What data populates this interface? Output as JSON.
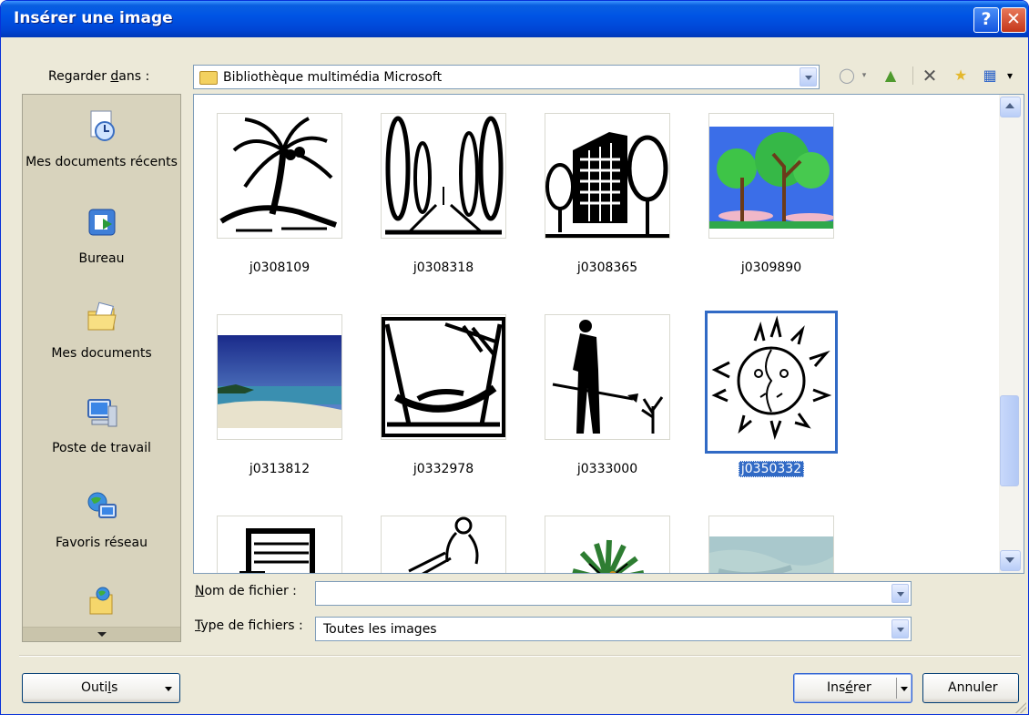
{
  "window": {
    "title": "Insérer une image",
    "help_glyph": "?",
    "close_glyph": "✕"
  },
  "look_in": {
    "label_prefix": "Regarder ",
    "label_access": "d",
    "label_suffix": "ans :",
    "value": "Bibliothèque multimédia Microsoft"
  },
  "toolbar": {
    "back": "◯",
    "up": "▲",
    "delete": "✕",
    "new_folder": "★",
    "views": "▦",
    "views_arrow": "▾"
  },
  "places": [
    {
      "label": "Mes documents récents",
      "icon": "recent-documents-icon"
    },
    {
      "label": "Bureau",
      "icon": "desktop-icon"
    },
    {
      "label": "Mes documents",
      "icon": "my-documents-icon"
    },
    {
      "label": "Poste de travail",
      "icon": "my-computer-icon"
    },
    {
      "label": "Favoris réseau",
      "icon": "network-places-icon"
    },
    {
      "label": "",
      "icon": "web-folder-icon"
    }
  ],
  "files": [
    {
      "name": "j0308109",
      "art": "palm-island"
    },
    {
      "name": "j0308318",
      "art": "tree-avenue"
    },
    {
      "name": "j0308365",
      "art": "building-trees"
    },
    {
      "name": "j0309890",
      "art": "color-trees"
    },
    {
      "name": "j0313812",
      "art": "beach-photo"
    },
    {
      "name": "j0332978",
      "art": "hammock"
    },
    {
      "name": "j0333000",
      "art": "person-shovel"
    },
    {
      "name": "j0350332",
      "art": "sun-face",
      "selected": true
    },
    {
      "name": "",
      "art": "radio"
    },
    {
      "name": "",
      "art": "reading-person"
    },
    {
      "name": "",
      "art": "plant"
    },
    {
      "name": "",
      "art": "blue-photo"
    }
  ],
  "file_name": {
    "label_access": "N",
    "label_rest": "om de fichier :",
    "value": ""
  },
  "file_type": {
    "label_access": "T",
    "label_rest": "ype de fichiers :",
    "value": "Toutes les images"
  },
  "buttons": {
    "tools_prefix": "Outi",
    "tools_access": "l",
    "tools_suffix": "s",
    "insert_prefix": "Ins",
    "insert_access": "é",
    "insert_suffix": "rer",
    "cancel": "Annuler"
  },
  "colors": {
    "titlebar": "#0055e5",
    "selection": "#316ac5",
    "dialog": "#ece9d8"
  }
}
